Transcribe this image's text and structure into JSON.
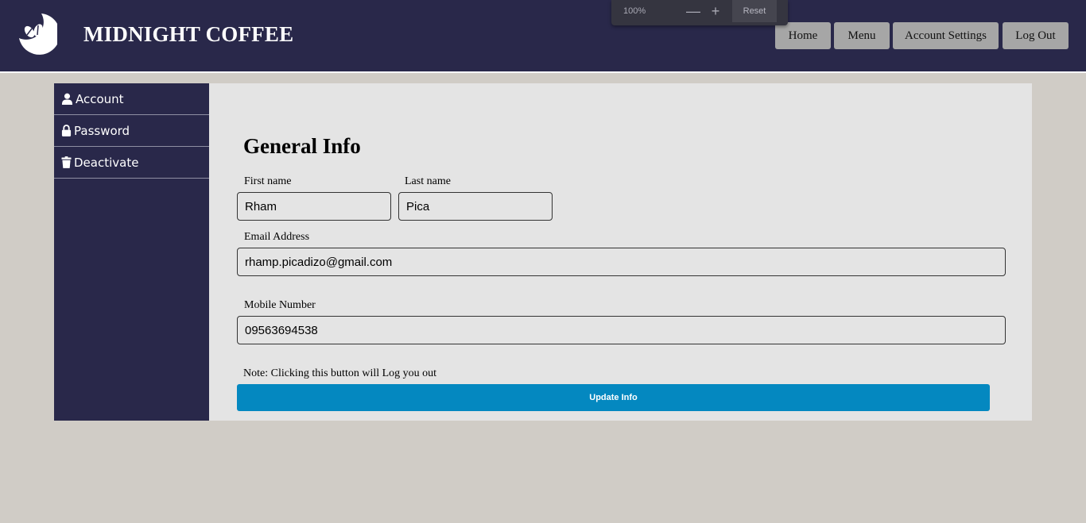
{
  "header": {
    "brand": "MIDNIGHT COFFEE",
    "nav": {
      "home": "Home",
      "menu": "Menu",
      "account_settings": "Account Settings",
      "logout": "Log Out"
    }
  },
  "zoom": {
    "level": "100%",
    "minus": "—",
    "plus": "+",
    "reset": "Reset"
  },
  "sidebar": {
    "items": [
      {
        "label": "Account",
        "icon": "user-icon"
      },
      {
        "label": "Password",
        "icon": "lock-icon"
      },
      {
        "label": "Deactivate",
        "icon": "trash-icon"
      }
    ]
  },
  "form": {
    "title": "General Info",
    "first_name_label": "First name",
    "first_name_value": "Rham",
    "last_name_label": "Last name",
    "last_name_value": "Pica",
    "email_label": "Email Address",
    "email_value": "rhamp.picadizo@gmail.com",
    "mobile_label": "Mobile Number",
    "mobile_value": "09563694538",
    "note": "Note: Clicking this button will Log you out",
    "submit_label": "Update Info"
  },
  "colors": {
    "header_bg": "#29284a",
    "page_bg": "#d0ccc6",
    "panel_bg": "#e4e4e4",
    "nav_button": "#a6a6a6",
    "accent": "#0488c0"
  }
}
